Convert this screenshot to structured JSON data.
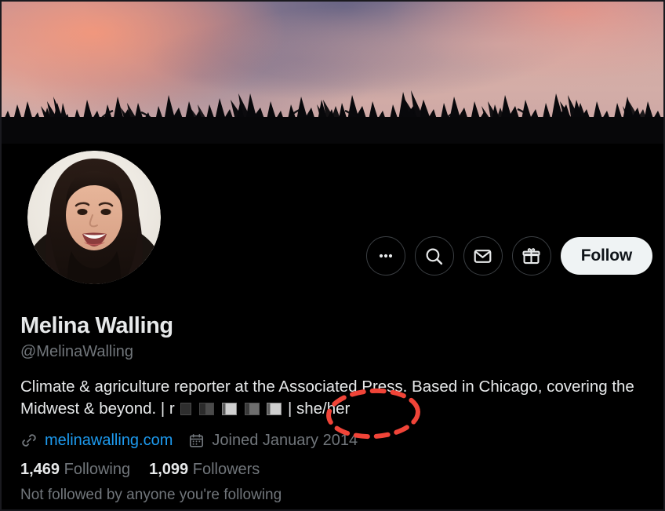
{
  "page": {
    "platform": "twitter-profile",
    "theme": "dark",
    "background_color": "#000000"
  },
  "banner": {
    "alt": "Sunset sky with pink and orange clouds over silhouetted corn field",
    "colors": {
      "sky_pink": "#d3ada7",
      "cloud_orange": "#f4907c",
      "cloud_purple": "#5c5c80",
      "corn_silhouette": "#070709"
    }
  },
  "avatar": {
    "alt": "Profile photo of smiling woman with dark wavy hair",
    "name": "avatar"
  },
  "actions": {
    "more_label": "More",
    "search_label": "Search",
    "message_label": "Message",
    "gift_label": "Gift subscription",
    "follow_label": "Follow",
    "follow_bg": "#eff3f4",
    "follow_fg": "#0f1419"
  },
  "profile": {
    "display_name": "Melina Walling",
    "handle": "@MelinaWalling",
    "bio_line_1": "Climate & agriculture reporter at the Associated Press. Based in Chicago, covering",
    "bio_line_2_start": "the Midwest & beyond. | r",
    "bio_line_2_end": "| she/her",
    "bio_full": "Climate & agriculture reporter at the Associated Press. Based in Chicago, covering the Midwest & beyond. | r ░ ░ ░ | she/her",
    "pronouns": "she/her",
    "website": "melinawalling.com",
    "website_color": "#1d9bf0",
    "joined": "Joined January 2014",
    "following_count": "1,469",
    "following_label": "Following",
    "followers_count": "1,099",
    "followers_label": "Followers",
    "followed_by": "Not followed by anyone you're following"
  },
  "annotation": {
    "type": "ellipse-highlight",
    "style": "dashed",
    "color": "#f04438",
    "targets": "she/her"
  },
  "icons": {
    "more": "more-horizontal-icon",
    "search": "search-icon",
    "message": "envelope-icon",
    "gift": "gift-icon",
    "link": "link-chain-icon",
    "calendar": "calendar-icon"
  }
}
